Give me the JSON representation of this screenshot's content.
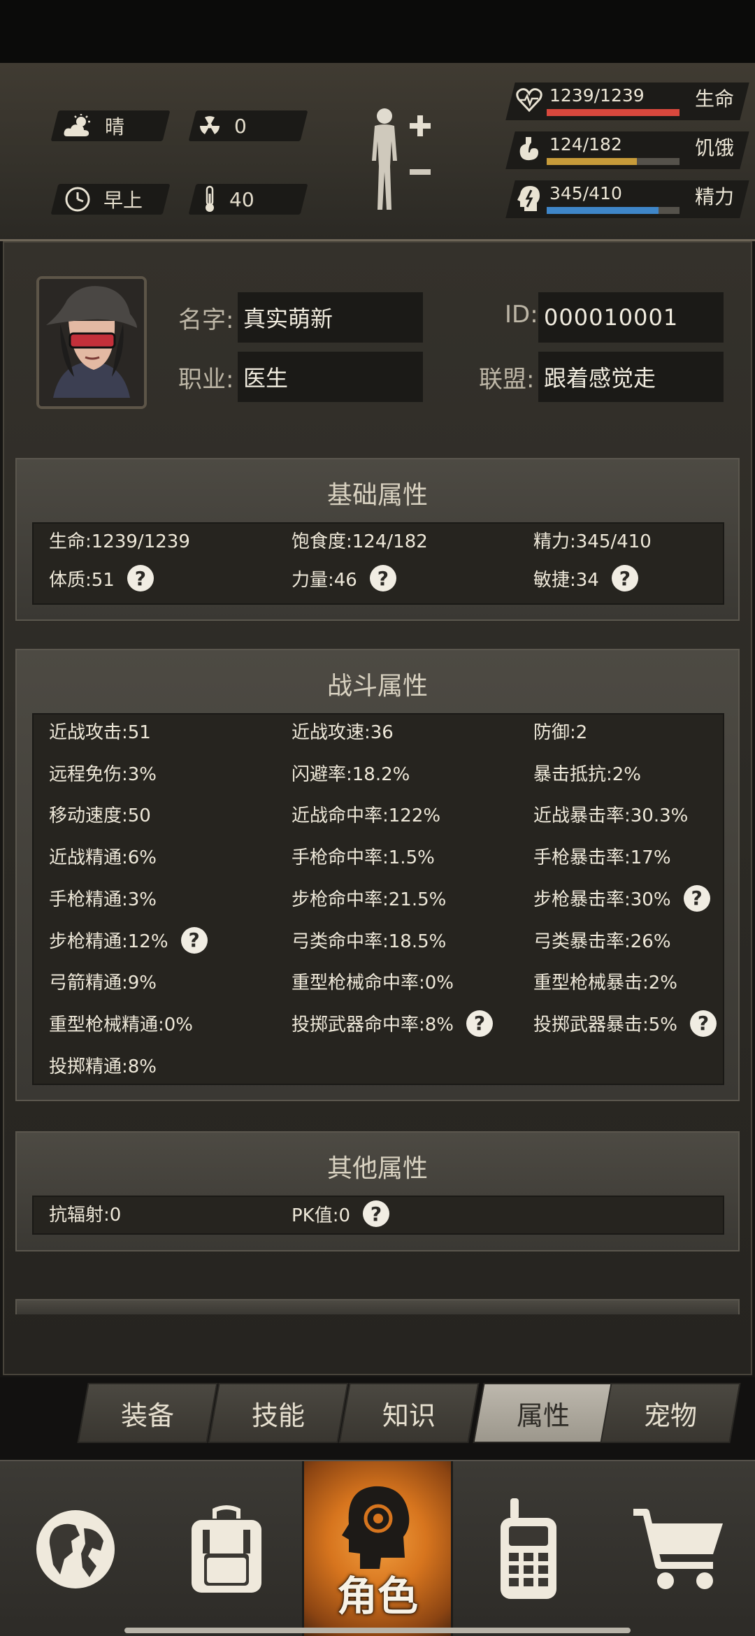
{
  "hud": {
    "weather": "晴",
    "radiation": "0",
    "time_of_day": "早上",
    "temperature": "40",
    "vitals": [
      {
        "name": "生命",
        "value": "1239/1239",
        "fill": 1.0,
        "color": "#d9483d",
        "icon": "heart-icon"
      },
      {
        "name": "饥饿",
        "value": "124/182",
        "fill": 0.68,
        "color": "#c79b3a",
        "icon": "stomach-icon"
      },
      {
        "name": "精力",
        "value": "345/410",
        "fill": 0.84,
        "color": "#3f86c8",
        "icon": "energy-head-icon"
      }
    ]
  },
  "profile": {
    "name_label": "名字:",
    "name_value": "真实萌新",
    "id_label": "ID:",
    "id_value": "000010001",
    "job_label": "职业:",
    "job_value": "医生",
    "alliance_label": "联盟:",
    "alliance_value": "跟着感觉走"
  },
  "basic": {
    "title": "基础属性",
    "stats": [
      {
        "text": "生命:1239/1239",
        "help": false
      },
      {
        "text": "饱食度:124/182",
        "help": false
      },
      {
        "text": "精力:345/410",
        "help": false
      },
      {
        "text": "体质:51",
        "help": true
      },
      {
        "text": "力量:46",
        "help": true
      },
      {
        "text": "敏捷:34",
        "help": true
      }
    ]
  },
  "combat": {
    "title": "战斗属性",
    "stats": [
      {
        "text": "近战攻击:51",
        "help": false
      },
      {
        "text": "近战攻速:36",
        "help": false
      },
      {
        "text": "防御:2",
        "help": false
      },
      {
        "text": "远程免伤:3%",
        "help": false
      },
      {
        "text": "闪避率:18.2%",
        "help": false
      },
      {
        "text": "暴击抵抗:2%",
        "help": false
      },
      {
        "text": "移动速度:50",
        "help": false
      },
      {
        "text": "近战命中率:122%",
        "help": false
      },
      {
        "text": "近战暴击率:30.3%",
        "help": false
      },
      {
        "text": "近战精通:6%",
        "help": false
      },
      {
        "text": "手枪命中率:1.5%",
        "help": false
      },
      {
        "text": "手枪暴击率:17%",
        "help": false
      },
      {
        "text": "手枪精通:3%",
        "help": false
      },
      {
        "text": "步枪命中率:21.5%",
        "help": false
      },
      {
        "text": "步枪暴击率:30%",
        "help": true
      },
      {
        "text": "步枪精通:12%",
        "help": true
      },
      {
        "text": "弓类命中率:18.5%",
        "help": false
      },
      {
        "text": "弓类暴击率:26%",
        "help": false
      },
      {
        "text": "弓箭精通:9%",
        "help": false
      },
      {
        "text": "重型枪械命中率:0%",
        "help": false
      },
      {
        "text": "重型枪械暴击:2%",
        "help": false
      },
      {
        "text": "重型枪械精通:0%",
        "help": false
      },
      {
        "text": "投掷武器命中率:8%",
        "help": true
      },
      {
        "text": "投掷武器暴击:5%",
        "help": true
      },
      {
        "text": "投掷精通:8%",
        "help": false
      }
    ]
  },
  "other": {
    "title": "其他属性",
    "stats": [
      {
        "text": "抗辐射:0",
        "help": false
      },
      {
        "text": "PK值:0",
        "help": true
      }
    ]
  },
  "tabs": [
    {
      "label": "装备",
      "active": false
    },
    {
      "label": "技能",
      "active": false
    },
    {
      "label": "知识",
      "active": false
    },
    {
      "label": "属性",
      "active": true
    },
    {
      "label": "宠物",
      "active": false
    }
  ],
  "nav": {
    "items": [
      {
        "icon": "globe-icon"
      },
      {
        "icon": "backpack-icon"
      },
      {
        "icon": "character-head-icon",
        "label": "角色",
        "active": true
      },
      {
        "icon": "walkie-talkie-icon"
      },
      {
        "icon": "shopping-cart-icon"
      }
    ],
    "active_label": "角色"
  }
}
